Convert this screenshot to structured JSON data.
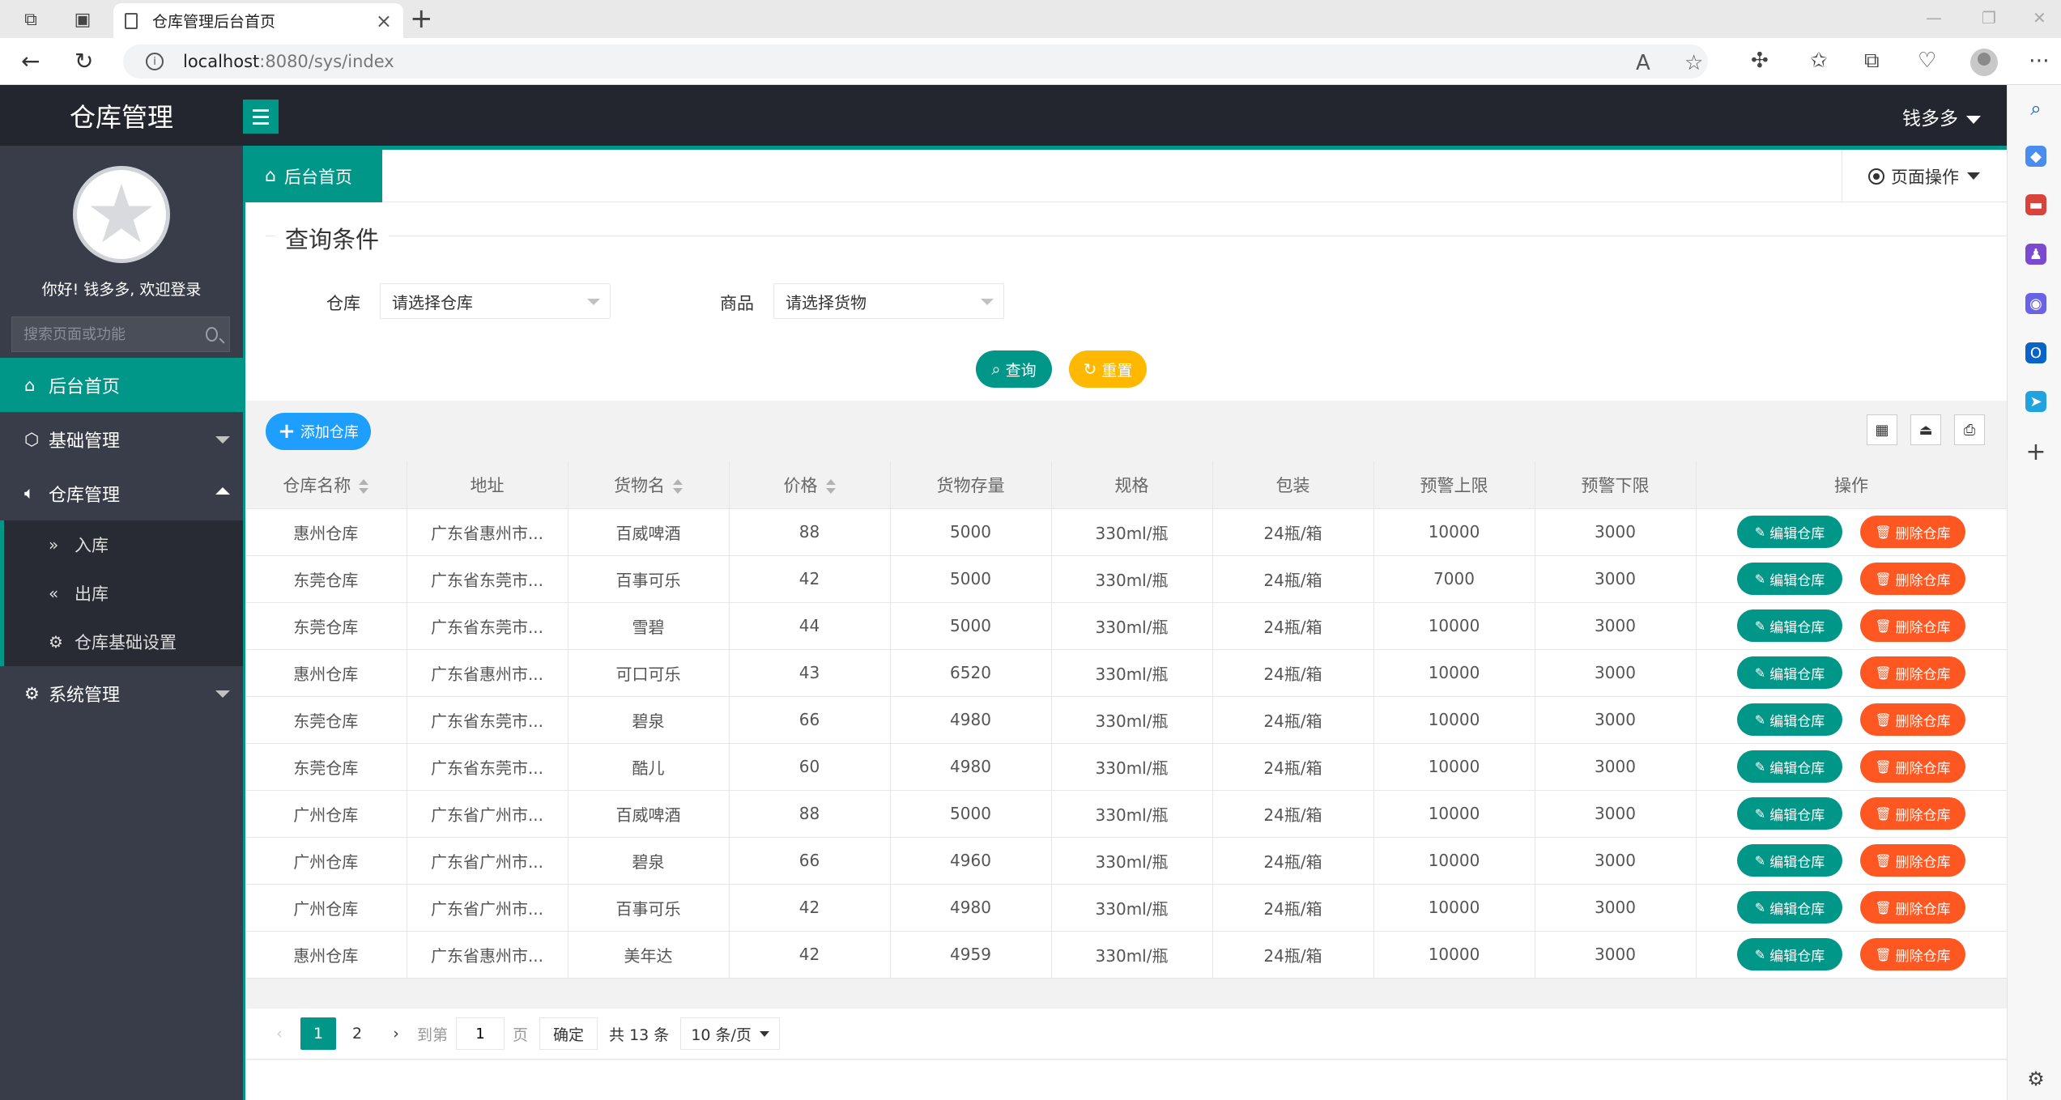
{
  "browser": {
    "tab_title": "仓库管理后台首页",
    "url_host": "localhost",
    "url_rest": ":8080/sys/index"
  },
  "app": {
    "logo": "仓库管理",
    "user_name": "钱多多",
    "welcome": "你好! 钱多多, 欢迎登录",
    "search_placeholder": "搜索页面或功能",
    "menu": {
      "home": "后台首页",
      "basic": "基础管理",
      "warehouse": "仓库管理",
      "sub_in": "入库",
      "sub_out": "出库",
      "sub_settings": "仓库基础设置",
      "system": "系统管理"
    },
    "home_tab": "后台首页",
    "page_ops": "页面操作"
  },
  "query": {
    "legend": "查询条件",
    "warehouse_label": "仓库",
    "warehouse_placeholder": "请选择仓库",
    "goods_label": "商品",
    "goods_placeholder": "请选择货物",
    "search_btn": "查询",
    "reset_btn": "重置"
  },
  "toolbar": {
    "add_btn": "添加仓库"
  },
  "table": {
    "headers": [
      "仓库名称",
      "地址",
      "货物名",
      "价格",
      "货物存量",
      "规格",
      "包装",
      "预警上限",
      "预警下限",
      "操作"
    ],
    "edit_label": "编辑仓库",
    "delete_label": "删除仓库",
    "rows": [
      [
        "惠州仓库",
        "广东省惠州市...",
        "百威啤酒",
        "88",
        "5000",
        "330ml/瓶",
        "24瓶/箱",
        "10000",
        "3000"
      ],
      [
        "东莞仓库",
        "广东省东莞市...",
        "百事可乐",
        "42",
        "5000",
        "330ml/瓶",
        "24瓶/箱",
        "7000",
        "3000"
      ],
      [
        "东莞仓库",
        "广东省东莞市...",
        "雪碧",
        "44",
        "5000",
        "330ml/瓶",
        "24瓶/箱",
        "10000",
        "3000"
      ],
      [
        "惠州仓库",
        "广东省惠州市...",
        "可口可乐",
        "43",
        "6520",
        "330ml/瓶",
        "24瓶/箱",
        "10000",
        "3000"
      ],
      [
        "东莞仓库",
        "广东省东莞市...",
        "碧泉",
        "66",
        "4980",
        "330ml/瓶",
        "24瓶/箱",
        "10000",
        "3000"
      ],
      [
        "东莞仓库",
        "广东省东莞市...",
        "酷儿",
        "60",
        "4980",
        "330ml/瓶",
        "24瓶/箱",
        "10000",
        "3000"
      ],
      [
        "广州仓库",
        "广东省广州市...",
        "百威啤酒",
        "88",
        "5000",
        "330ml/瓶",
        "24瓶/箱",
        "10000",
        "3000"
      ],
      [
        "广州仓库",
        "广东省广州市...",
        "碧泉",
        "66",
        "4960",
        "330ml/瓶",
        "24瓶/箱",
        "10000",
        "3000"
      ],
      [
        "广州仓库",
        "广东省广州市...",
        "百事可乐",
        "42",
        "4980",
        "330ml/瓶",
        "24瓶/箱",
        "10000",
        "3000"
      ],
      [
        "惠州仓库",
        "广东省惠州市...",
        "美年达",
        "42",
        "4959",
        "330ml/瓶",
        "24瓶/箱",
        "10000",
        "3000"
      ]
    ]
  },
  "pager": {
    "page1": "1",
    "page2": "2",
    "goto_label": "到第",
    "goto_value": "1",
    "page_unit": "页",
    "confirm": "确定",
    "total": "共 13 条",
    "size": "10 条/页"
  },
  "colors": {
    "accent": "#009688",
    "danger": "#ff5722",
    "warning": "#ffb800",
    "primary": "#1e9fff",
    "header_bg": "#23262e",
    "sidebar_bg": "#393d49"
  }
}
